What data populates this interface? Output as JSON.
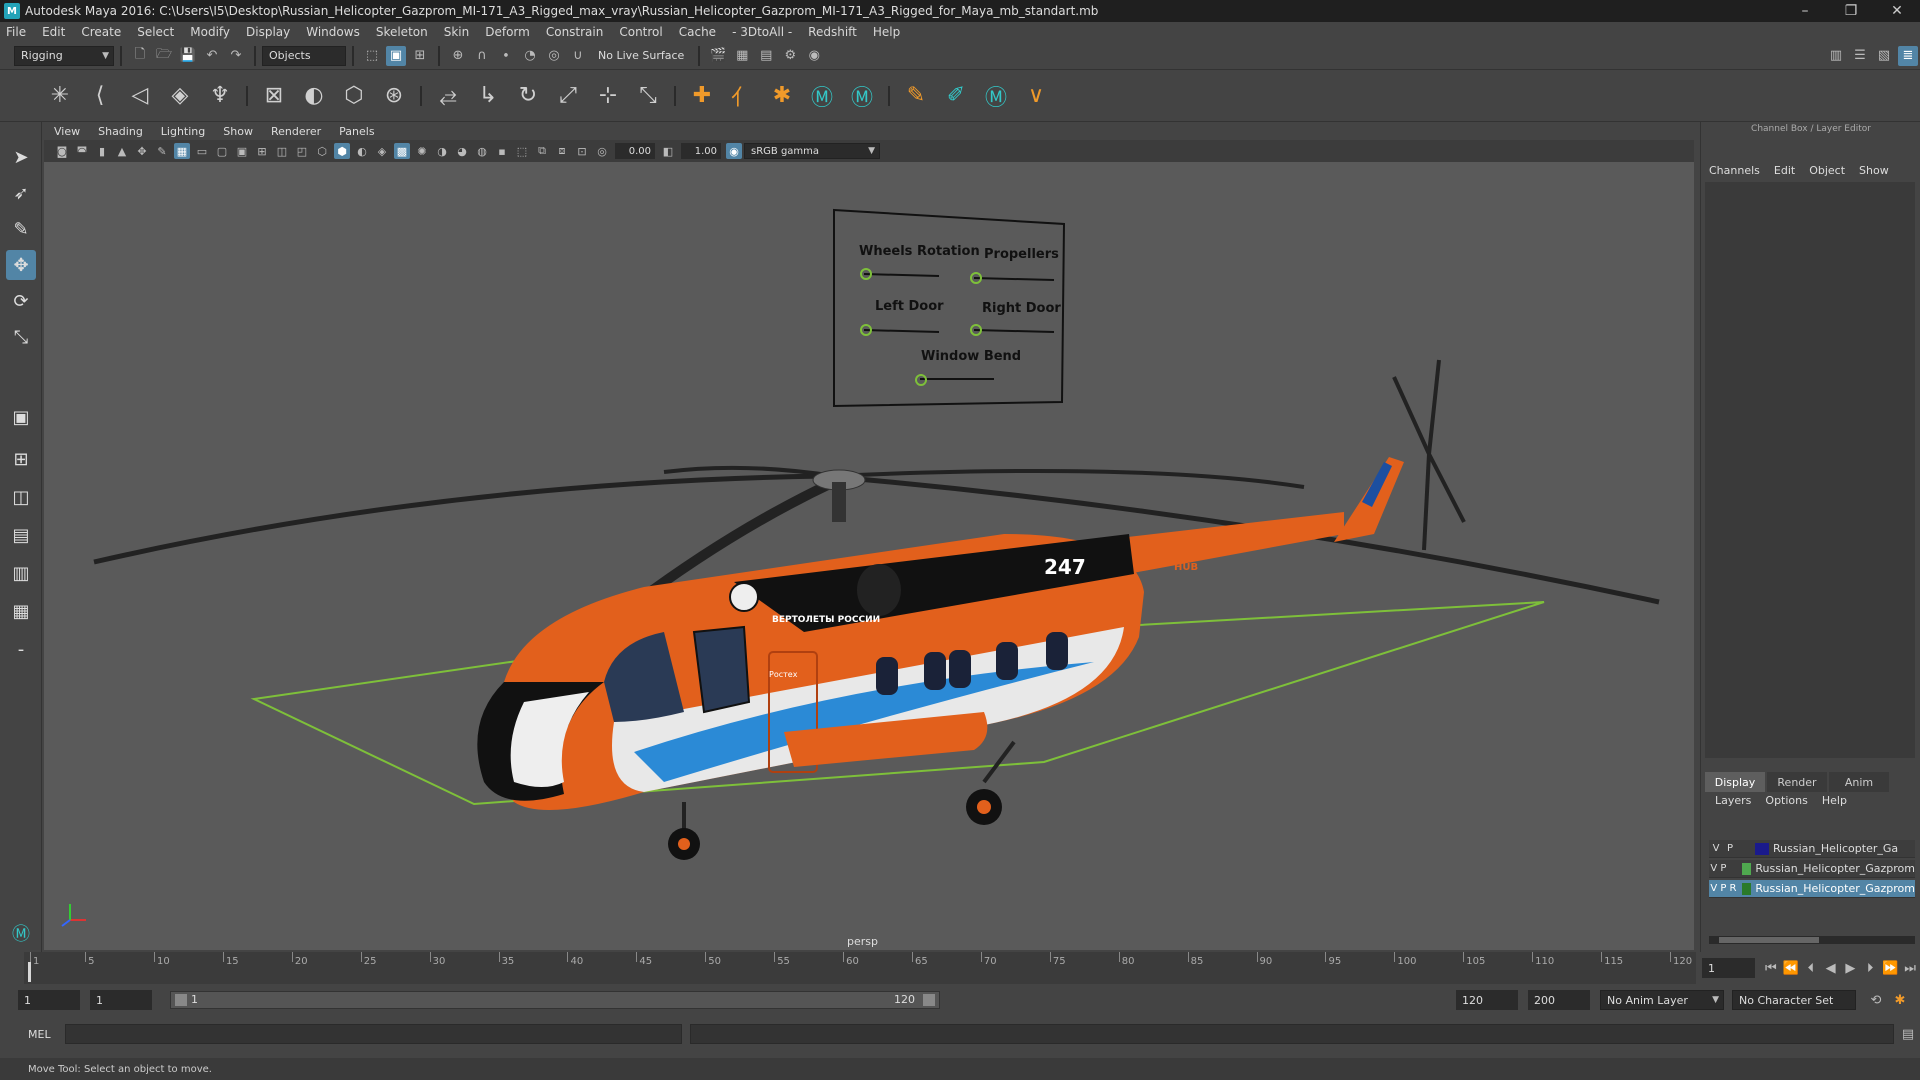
{
  "window": {
    "title": "Autodesk Maya 2016: C:\\Users\\I5\\Desktop\\Russian_Helicopter_Gazprom_MI-171_A3_Rigged_max_vray\\Russian_Helicopter_Gazprom_MI-171_A3_Rigged_for_Maya_mb_standart.mb",
    "logo": "M",
    "minimize": "–",
    "maximize": "❐",
    "close": "✕"
  },
  "menubar": [
    "File",
    "Edit",
    "Create",
    "Select",
    "Modify",
    "Display",
    "Windows",
    "Skeleton",
    "Skin",
    "Deform",
    "Constrain",
    "Control",
    "Cache",
    "- 3DtoAll -",
    "Redshift",
    "Help"
  ],
  "statusline": {
    "mode": "Rigging",
    "selection_mode": "Objects",
    "live_surface": "No Live Surface"
  },
  "panel": {
    "menu": [
      "View",
      "Shading",
      "Lighting",
      "Show",
      "Renderer",
      "Panels"
    ],
    "exposure": "0.00",
    "gamma": "1.00",
    "colorspace": "sRGB gamma",
    "camera": "persp"
  },
  "rig_panel": {
    "labels": {
      "wheels": "Wheels Rotation",
      "propellers": "Propellers",
      "left_door": "Left Door",
      "right_door": "Right Door",
      "window_bend": "Window Bend"
    }
  },
  "helicopter": {
    "tail_number": "247",
    "side_logo": "ВЕРТОЛЕТЫ РОССИИ",
    "rostec": "Ростех",
    "hub": "HUB"
  },
  "channelbox": {
    "title": "Channel Box / Layer Editor",
    "menu": [
      "Channels",
      "Edit",
      "Object",
      "Show"
    ]
  },
  "layer_editor": {
    "tabs": [
      "Display",
      "Render",
      "Anim"
    ],
    "menu": [
      "Layers",
      "Options",
      "Help"
    ],
    "layers": [
      {
        "v": "V",
        "p": "P",
        "r": "",
        "name": "Russian_Helicopter_Ga",
        "color": "#1a1a8c"
      },
      {
        "v": "V",
        "p": "P",
        "r": "",
        "name": "Russian_Helicopter_Gazprom",
        "color": "#4fa84f"
      },
      {
        "v": "V",
        "p": "P",
        "r": "R",
        "name": "Russian_Helicopter_Gazprom",
        "color": "#2a7a2a"
      }
    ]
  },
  "timeline": {
    "ticks": [
      1,
      5,
      10,
      15,
      20,
      25,
      30,
      35,
      40,
      45,
      50,
      55,
      60,
      65,
      70,
      75,
      80,
      85,
      90,
      95,
      100,
      105,
      110,
      115,
      120
    ],
    "current_frame": "1"
  },
  "range": {
    "start": "1",
    "playback_start": "1",
    "slider_start": "1",
    "slider_end": "120",
    "playback_end": "120",
    "end": "200",
    "anim_layer": "No Anim Layer",
    "char_set": "No Character Set"
  },
  "cmdline": {
    "label": "MEL"
  },
  "helpline": {
    "text": "Move Tool: Select an object to move."
  }
}
